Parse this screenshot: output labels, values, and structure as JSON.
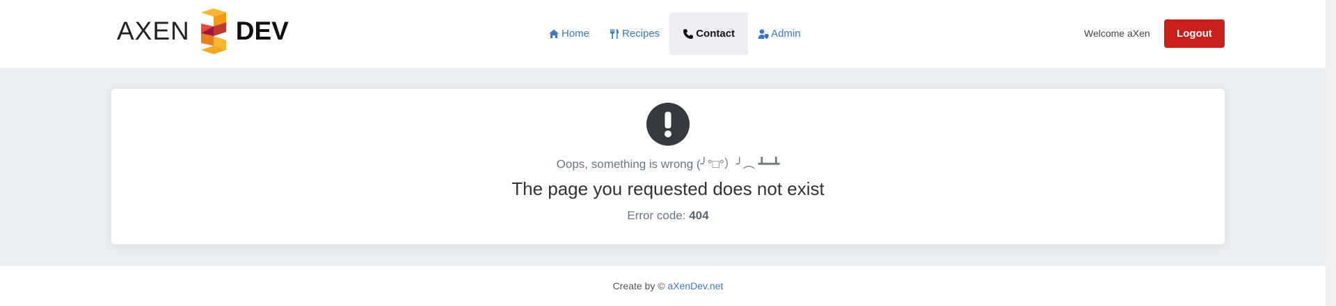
{
  "header": {
    "logo": {
      "left_text": "AXEN",
      "right_text": "DEV"
    },
    "nav": [
      {
        "label": "Home",
        "icon": "home-icon",
        "active": false
      },
      {
        "label": "Recipes",
        "icon": "utensils-icon",
        "active": false
      },
      {
        "label": "Contact",
        "icon": "phone-icon",
        "active": true
      },
      {
        "label": "Admin",
        "icon": "user-shield-icon",
        "active": false
      }
    ],
    "welcome": "Welcome aXen",
    "logout_label": "Logout"
  },
  "error": {
    "icon": "exclamation-circle-icon",
    "oops": "Oops, something is wrong (╯°□°）╯︵ ┻━┻",
    "headline": "The page you requested does not exist",
    "code_label": "Error code:",
    "code": "404"
  },
  "footer": {
    "prefix": "Create by ©",
    "link": "aXenDev.net"
  },
  "colors": {
    "accent": "#3a78c2",
    "logout": "#c8201c",
    "page_bg": "#e9ecf1",
    "logo_orange": "#f5a623",
    "logo_red": "#d63031",
    "logo_magenta": "#a3173f"
  }
}
